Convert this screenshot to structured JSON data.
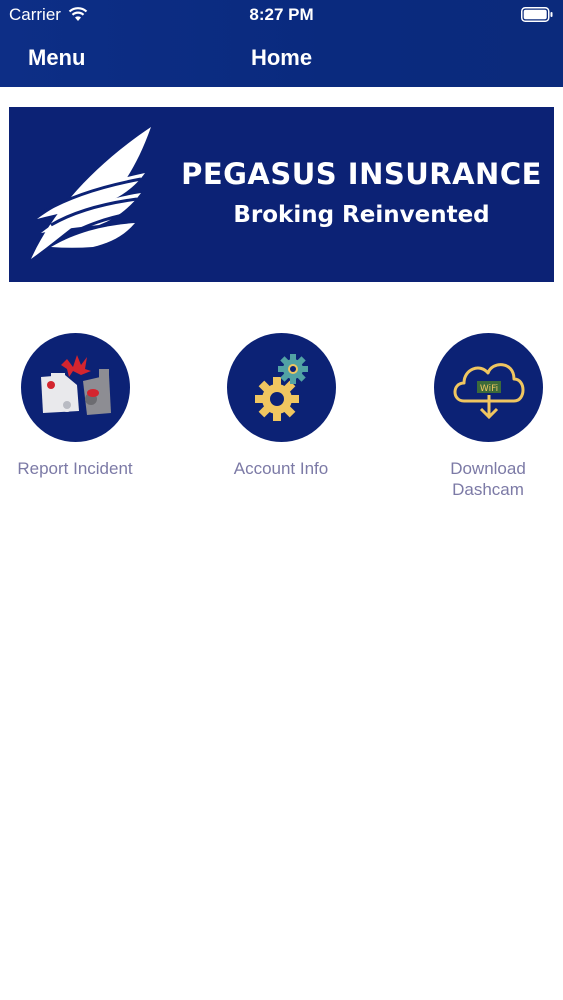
{
  "status_bar": {
    "carrier": "Carrier",
    "time": "8:27 PM"
  },
  "nav": {
    "menu_label": "Menu",
    "title": "Home"
  },
  "banner": {
    "brand": "PEGASUS INSURANCE",
    "tagline": "Broking Reinvented"
  },
  "actions": [
    {
      "label": "Report Incident",
      "icon": "car-crash-icon"
    },
    {
      "label": "Account Info",
      "icon": "gears-icon"
    },
    {
      "label": "Download\nDashcam",
      "icon": "cloud-wifi-download-icon"
    }
  ],
  "colors": {
    "nav_bg": "#0d2e86",
    "banner_bg": "#0c2275",
    "label_text": "#7c7aa6"
  }
}
